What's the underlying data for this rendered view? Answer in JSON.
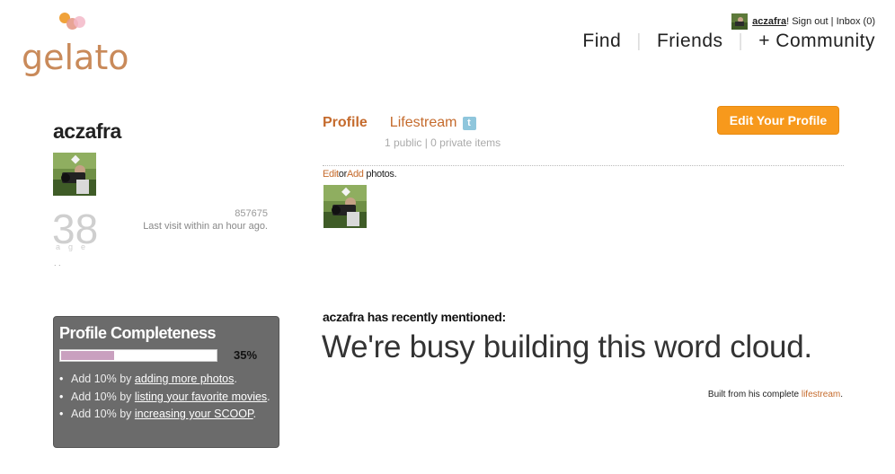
{
  "logo": {
    "text": "gelato"
  },
  "account": {
    "username": "aczafra",
    "after_name": "! ",
    "sign_out": "Sign out",
    "sep": " | ",
    "inbox": "Inbox (0)"
  },
  "nav": {
    "items": [
      "Find",
      "Friends",
      "+ Community"
    ],
    "separator": "|"
  },
  "profile": {
    "username": "aczafra",
    "age": "38",
    "age_label": "age",
    "dots": ". .",
    "visit_count": "857675",
    "last_visit": "Last visit within an hour ago."
  },
  "completeness": {
    "title": "Profile Completeness",
    "percent_label": "35%",
    "progress": 0.35,
    "items": [
      {
        "prefix": "Add 10% by ",
        "link": "adding more photos",
        "suffix": "."
      },
      {
        "prefix": "Add 10% by ",
        "link": "listing your favorite movies",
        "suffix": "."
      },
      {
        "prefix": "Add 10% by ",
        "link": "increasing your SCOOP",
        "suffix": "."
      }
    ]
  },
  "tabs": {
    "profile": "Profile",
    "lifestream": "Lifestream",
    "lifestream_sub": "1 public | 0 private items",
    "twitter_glyph": "t"
  },
  "edit_button": "Edit Your Profile",
  "photos": {
    "edit": "Edit",
    "or": "or",
    "add": "Add",
    "suffix": "photos."
  },
  "mentions": {
    "heading": "aczafra has recently mentioned:",
    "cloud_message": "We're busy building this word cloud.",
    "built_prefix": "Built from his complete ",
    "built_link": "lifestream",
    "built_suffix": "."
  },
  "colors": {
    "accent_orange": "#c56b2d",
    "button_orange": "#f7991c",
    "progress_fill": "#c9a0bf",
    "panel_gray": "#6b6b6b"
  }
}
